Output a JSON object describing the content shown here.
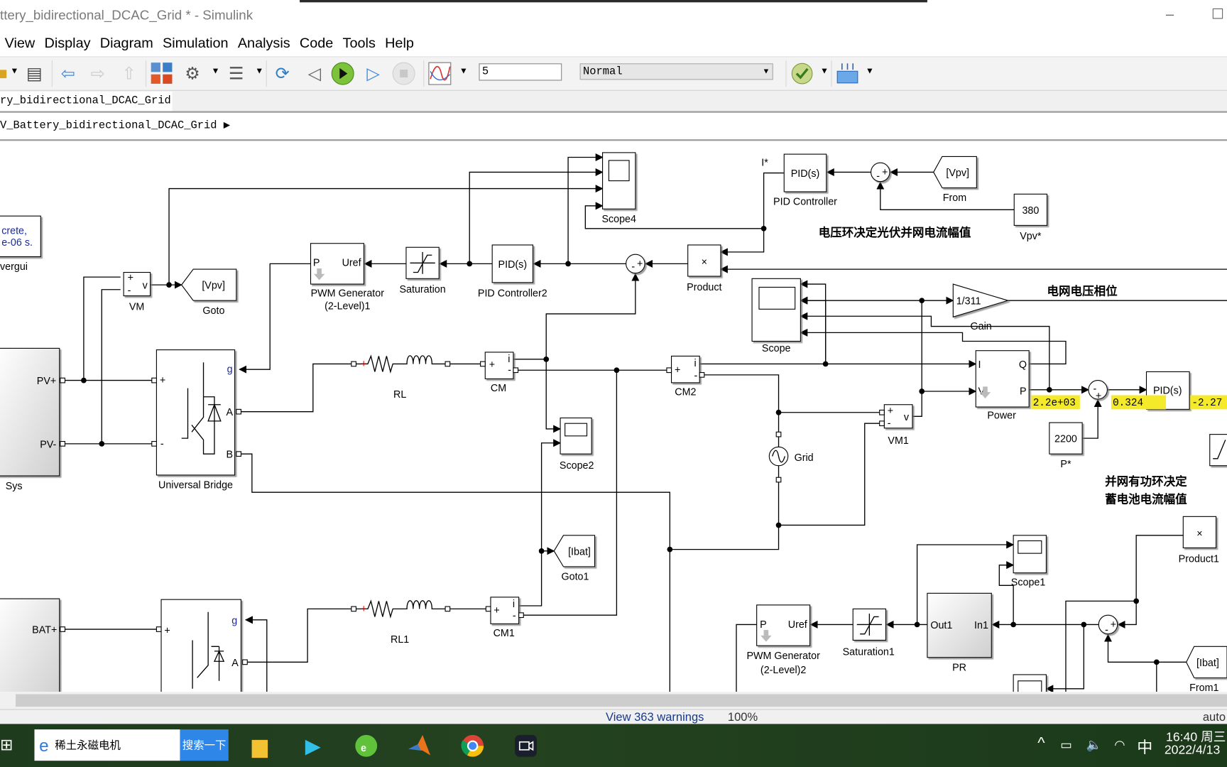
{
  "window": {
    "title": "ttery_bidirectional_DCAC_Grid * - Simulink",
    "minimize": "–",
    "maximize": "☐"
  },
  "menu": [
    "View",
    "Display",
    "Diagram",
    "Simulation",
    "Analysis",
    "Code",
    "Tools",
    "Help"
  ],
  "toolbar": {
    "icons": [
      "open-folder-icon",
      "save-icon",
      "back-icon",
      "forward-icon",
      "up-icon",
      "library-browser-icon",
      "model-settings-icon",
      "model-explorer-icon",
      "update-diagram-icon",
      "step-back-icon",
      "run-icon",
      "step-forward-icon",
      "stop-icon",
      "simulation-data-inspector-icon",
      "model-advisor-icon",
      "signal-table-icon"
    ],
    "stop_time": "5",
    "sim_mode": "Normal"
  },
  "tab": {
    "label": "ry_bidirectional_DCAC_Grid"
  },
  "breadcrumb": {
    "path": "V_Battery_bidirectional_DCAC_Grid",
    "arrow": "▶"
  },
  "diagram": {
    "powergui": {
      "line1": "crete,",
      "line2": "e-06 s.",
      "label": "vergui"
    },
    "sys": {
      "label": "Sys",
      "port_pos": "PV+",
      "port_neg": "PV-"
    },
    "vm": {
      "label": "VM",
      "plus": "+",
      "minus": "-",
      "out": "v"
    },
    "goto": {
      "tag": "[Vpv]",
      "label": "Goto"
    },
    "universal_bridge": {
      "label": "Universal Bridge",
      "g": "g",
      "a": "A",
      "b": "B",
      "plus": "+",
      "minus": "-"
    },
    "pwm1": {
      "label1": "PWM Generator",
      "label2": "(2-Level)1",
      "p": "P",
      "uref": "Uref"
    },
    "saturation": {
      "label": "Saturation"
    },
    "pid2": {
      "text": "PID(s)",
      "label": "PID Controller2"
    },
    "scope4": {
      "label": "Scope4"
    },
    "product": {
      "text": "×",
      "label": "Product"
    },
    "pid": {
      "text": "PID(s)",
      "label": "PID Controller",
      "signal": "I*"
    },
    "from": {
      "tag": "[Vpv]",
      "label": "From"
    },
    "vpv_ref": {
      "value": "380",
      "label": "Vpv*"
    },
    "scope": {
      "label": "Scope"
    },
    "gain": {
      "value": "1/311",
      "label": "Gain"
    },
    "power": {
      "label": "Power",
      "i": "I",
      "q": "Q",
      "v": "V",
      "p": "P"
    },
    "rl": {
      "label": "RL"
    },
    "cm": {
      "label": "CM",
      "plus": "+",
      "minus": "-",
      "out": "i"
    },
    "cm2": {
      "label": "CM2",
      "plus": "+",
      "minus": "-",
      "out": "i"
    },
    "scope2": {
      "label": "Scope2"
    },
    "grid": {
      "label": "Grid"
    },
    "vm1": {
      "label": "VM1",
      "plus": "+",
      "minus": "-",
      "out": "v"
    },
    "p_ref": {
      "value": "2200",
      "label": "P*"
    },
    "pid3": {
      "text": "PID(s)"
    },
    "displays": [
      "2.2e+03",
      "0.324",
      "-2.27"
    ],
    "product1": {
      "text": "×",
      "label": "Product1"
    },
    "goto1": {
      "tag": "[Ibat]",
      "label": "Goto1"
    },
    "scope1": {
      "label": "Scope1"
    },
    "rl1": {
      "label": "RL1"
    },
    "cm1": {
      "label": "CM1",
      "plus": "+",
      "minus": "-",
      "out": "i"
    },
    "bat": {
      "port": "BAT+"
    },
    "bridge2": {
      "g": "g",
      "a": "A",
      "plus": "+"
    },
    "pwm2": {
      "label1": "PWM Generator",
      "label2": "(2-Level)2",
      "p": "P",
      "uref": "Uref"
    },
    "saturation1": {
      "label": "Saturation1"
    },
    "pr": {
      "label": "PR",
      "out": "Out1",
      "in": "In1"
    },
    "from1": {
      "tag": "[Ibat]",
      "label": "From1"
    },
    "annotations": {
      "voltage_loop": "电压环决定光伏并网电流幅值",
      "grid_phase": "电网电压相位",
      "power_loop1": "并网有功环决定",
      "power_loop2": "蓄电池电流幅值"
    }
  },
  "status": {
    "warnings": "View 363 warnings",
    "zoom": "100%",
    "solver": "auto"
  },
  "taskbar": {
    "search_text": "稀土永磁电机",
    "search_button": "搜索一下",
    "apps": [
      "file-explorer-icon",
      "video-player-icon",
      "360-browser-icon",
      "matlab-icon",
      "chrome-icon",
      "camera-app-icon"
    ],
    "tray": {
      "chevron": "^",
      "ime": "中",
      "time": "16:40 周三",
      "date": "2022/4/13"
    }
  }
}
